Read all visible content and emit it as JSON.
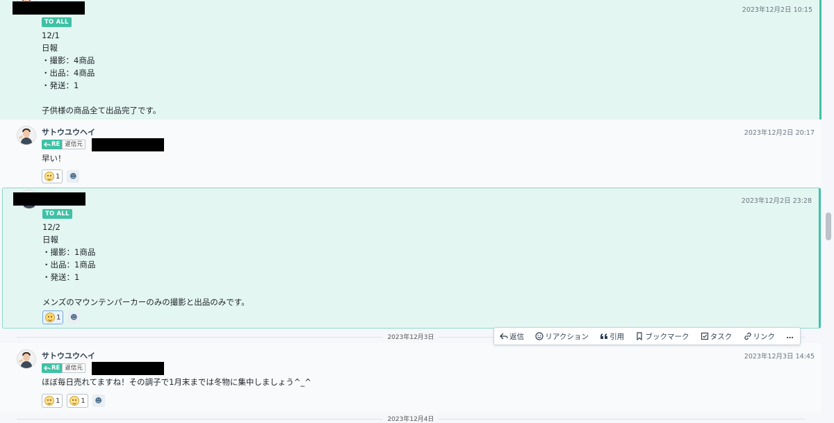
{
  "messages": [
    {
      "time": "2023年12月2日 10:15",
      "badge": "TO ALL",
      "lines": [
        "12/1",
        "日報",
        "・撮影：4商品",
        "・出品：4商品",
        "・発送：1",
        "",
        "子供様の商品全て出品完了です。"
      ]
    },
    {
      "sender": "サトウユウヘイ",
      "time": "2023年12月2日 20:17",
      "re_label": "RE",
      "source_label": "返信元",
      "lines": [
        "早い！"
      ],
      "reactions": [
        {
          "count": "1",
          "emoji": "sweat-smile-icon"
        }
      ]
    },
    {
      "time": "2023年12月2日 23:28",
      "badge": "TO ALL",
      "lines": [
        "12/2",
        "日報",
        "・撮影：1商品",
        "・出品：1商品",
        "・発送：1",
        "",
        "メンズのマウンテンパーカーのみの撮影と出品のみです。"
      ],
      "reactions": [
        {
          "count": "1",
          "emoji": "smile-icon"
        }
      ]
    },
    {
      "sender": "サトウユウヘイ",
      "time": "2023年12月3日 14:45",
      "re_label": "RE",
      "source_label": "返信元",
      "lines": [
        "ほぼ毎日売れてますね！その調子で1月末までは冬物に集中しましょう^_^"
      ],
      "reactions": [
        {
          "count": "1",
          "emoji": "sweat-smile-icon"
        },
        {
          "count": "1",
          "emoji": "scream-icon"
        }
      ]
    }
  ],
  "date_separators": [
    "2023年12月3日",
    "2023年12月4日"
  ],
  "toolbar": {
    "reply": "返信",
    "reaction": "リアクション",
    "quote": "引用",
    "bookmark": "ブックマーク",
    "task": "タスク",
    "link": "リンク",
    "more": "…"
  },
  "colors": {
    "accent": "#3fc1a5",
    "to_all_bg": "#e3f6f1"
  }
}
